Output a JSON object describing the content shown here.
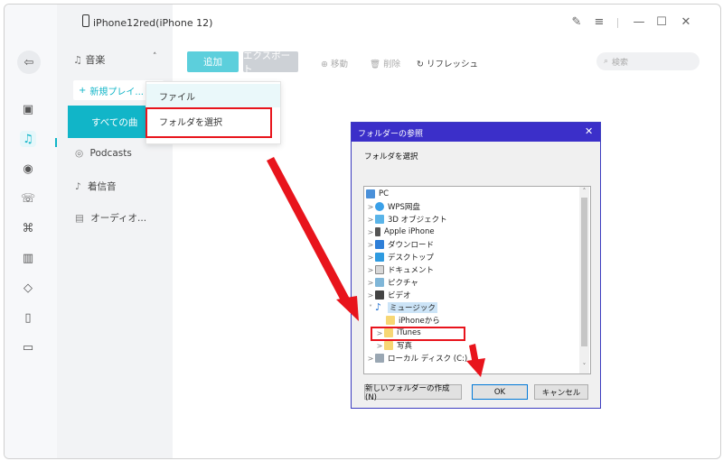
{
  "window": {
    "device_name": "iPhone12red(iPhone 12)"
  },
  "sidebar": {
    "music_header": "音楽",
    "new_playlist": "新規プレイ...",
    "all_songs": "すべての曲",
    "podcasts": "Podcasts",
    "ringtones": "着信音",
    "audiobooks": "オーディオ..."
  },
  "toolbar": {
    "add": "追加",
    "export": "エクスポート",
    "move": "移動",
    "delete": "削除",
    "refresh": "リフレッシュ",
    "search_placeholder": "検索"
  },
  "add_menu": {
    "file": "ファイル",
    "select_folder": "フォルダを選択"
  },
  "dialog": {
    "title": "フォルダーの参照",
    "prompt": "フォルダを選択",
    "tree": [
      "PC",
      "WPS网盘",
      "3D オブジェクト",
      "Apple iPhone",
      "ダウンロード",
      "デスクトップ",
      "ドキュメント",
      "ピクチャ",
      "ビデオ",
      "ミュージック",
      "iPhoneから",
      "iTunes",
      "写真",
      "ローカル ディスク (C:)"
    ],
    "new_folder": "新しいフォルダーの作成(N)",
    "ok": "OK",
    "cancel": "キャンセル"
  },
  "colors": {
    "accent": "#11b5c8",
    "highlight": "#e8141c",
    "dialog_title": "#3b2fc9"
  }
}
